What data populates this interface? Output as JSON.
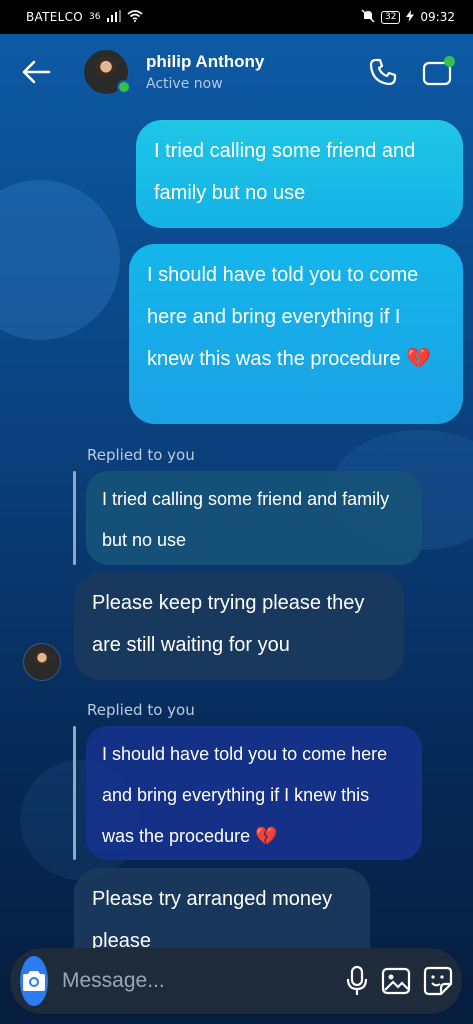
{
  "status_bar": {
    "carrier": "BATELCO",
    "network": "36",
    "battery": "32",
    "time": "09:32"
  },
  "header": {
    "name": "philip Anthony",
    "status": "Active now"
  },
  "messages": [
    {
      "type": "sent",
      "text": "I tried calling some friend and family but no use"
    },
    {
      "type": "sent",
      "text": "I should have told you to come here and bring everything if I knew this was the procedure 💔"
    },
    {
      "type": "reply",
      "replied_label": "Replied to you",
      "quoted": "I tried calling some friend and family but no use",
      "text": "Please keep trying please they are still waiting for you"
    },
    {
      "type": "reply",
      "replied_label": "Replied to you",
      "quoted": "I should have told you to come here and bring everything if I knew this was the procedure 💔",
      "text": "Please try arranged money please"
    }
  ],
  "composer": {
    "placeholder": "Message..."
  },
  "colors": {
    "accent": "#2d7bf0",
    "online": "#36c24a",
    "sent_bubble": "#1fc6e6"
  }
}
